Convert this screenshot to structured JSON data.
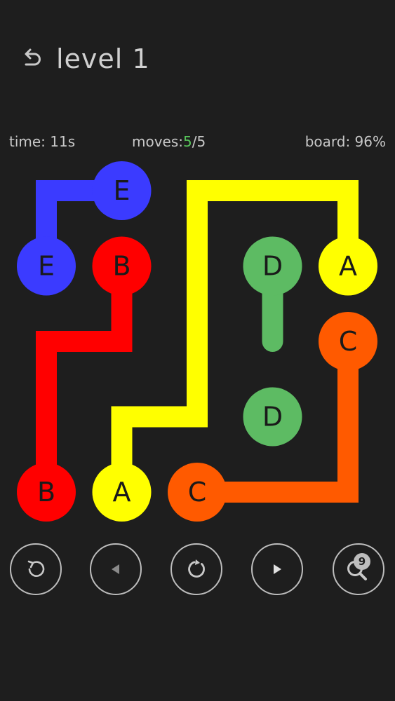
{
  "header": {
    "title": "level 1",
    "back_icon": "back-arrow-icon"
  },
  "stats": {
    "time_label": "time:",
    "time_value": "11s",
    "moves_label": "moves:",
    "moves_current": "5",
    "moves_separator": "/",
    "moves_total": "5",
    "board_label": "board:",
    "board_value": "96%"
  },
  "board": {
    "grid_size": 5,
    "colors": {
      "A": "#ffff00",
      "B": "#ff0000",
      "C": "#ff5a00",
      "D": "#5dbb63",
      "E": "#3b3bff"
    },
    "endpoints": [
      {
        "label": "E",
        "row": 0,
        "col": 1
      },
      {
        "label": "E",
        "row": 1,
        "col": 0
      },
      {
        "label": "B",
        "row": 1,
        "col": 1
      },
      {
        "label": "D",
        "row": 1,
        "col": 3
      },
      {
        "label": "A",
        "row": 1,
        "col": 4
      },
      {
        "label": "C",
        "row": 2,
        "col": 4
      },
      {
        "label": "D",
        "row": 3,
        "col": 3
      },
      {
        "label": "B",
        "row": 4,
        "col": 0
      },
      {
        "label": "A",
        "row": 4,
        "col": 1
      },
      {
        "label": "C",
        "row": 4,
        "col": 2
      }
    ],
    "paths": [
      {
        "label": "E",
        "cells": [
          [
            0,
            1
          ],
          [
            0,
            0
          ],
          [
            1,
            0
          ]
        ]
      },
      {
        "label": "B",
        "cells": [
          [
            1,
            1
          ],
          [
            2,
            1
          ],
          [
            2,
            0
          ],
          [
            3,
            0
          ],
          [
            4,
            0
          ]
        ]
      },
      {
        "label": "A",
        "cells": [
          [
            1,
            4
          ],
          [
            0,
            4
          ],
          [
            0,
            3
          ],
          [
            0,
            2
          ],
          [
            1,
            2
          ],
          [
            2,
            2
          ],
          [
            3,
            2
          ],
          [
            3,
            1
          ],
          [
            4,
            1
          ]
        ]
      },
      {
        "label": "C",
        "cells": [
          [
            2,
            4
          ],
          [
            3,
            4
          ],
          [
            4,
            4
          ],
          [
            4,
            3
          ],
          [
            4,
            2
          ]
        ]
      }
    ],
    "partial_paths": [
      {
        "label": "D",
        "cells": [
          [
            1,
            3
          ],
          [
            2,
            3
          ]
        ]
      }
    ]
  },
  "controls": [
    {
      "name": "undo-button",
      "icon": "undo-icon",
      "enabled": true
    },
    {
      "name": "previous-level-button",
      "icon": "play-left-icon",
      "enabled": false
    },
    {
      "name": "restart-button",
      "icon": "restart-icon",
      "enabled": true
    },
    {
      "name": "next-level-button",
      "icon": "play-right-icon",
      "enabled": true
    },
    {
      "name": "hint-button",
      "icon": "magnifier-icon",
      "enabled": true,
      "count": "9"
    }
  ]
}
